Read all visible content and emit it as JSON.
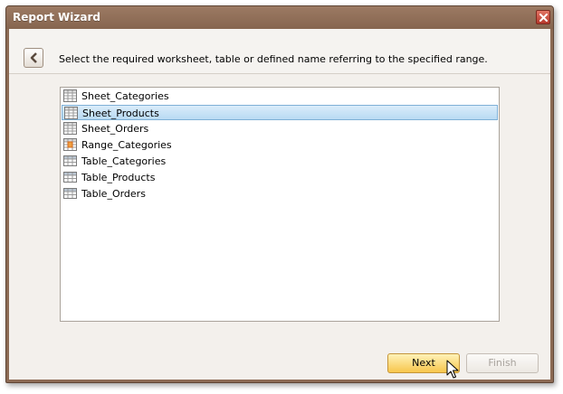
{
  "window": {
    "title": "Report Wizard",
    "title_color": "#8c6a54"
  },
  "header": {
    "instruction": "Select the required worksheet, table or defined name referring to the specified range."
  },
  "list": {
    "items": [
      {
        "label": "Sheet_Categories",
        "icon": "sheet-icon"
      },
      {
        "label": "Sheet_Products",
        "icon": "sheet-icon",
        "selected": true
      },
      {
        "label": "Sheet_Orders",
        "icon": "sheet-icon"
      },
      {
        "label": "Range_Categories",
        "icon": "named-range-icon"
      },
      {
        "label": "Table_Categories",
        "icon": "table-icon"
      },
      {
        "label": "Table_Products",
        "icon": "table-icon"
      },
      {
        "label": "Table_Orders",
        "icon": "table-icon"
      }
    ],
    "selection_color": "#c6e2f7"
  },
  "buttons": {
    "next_label": "Next",
    "finish_label": "Finish",
    "next_color": "#f7c64c"
  }
}
